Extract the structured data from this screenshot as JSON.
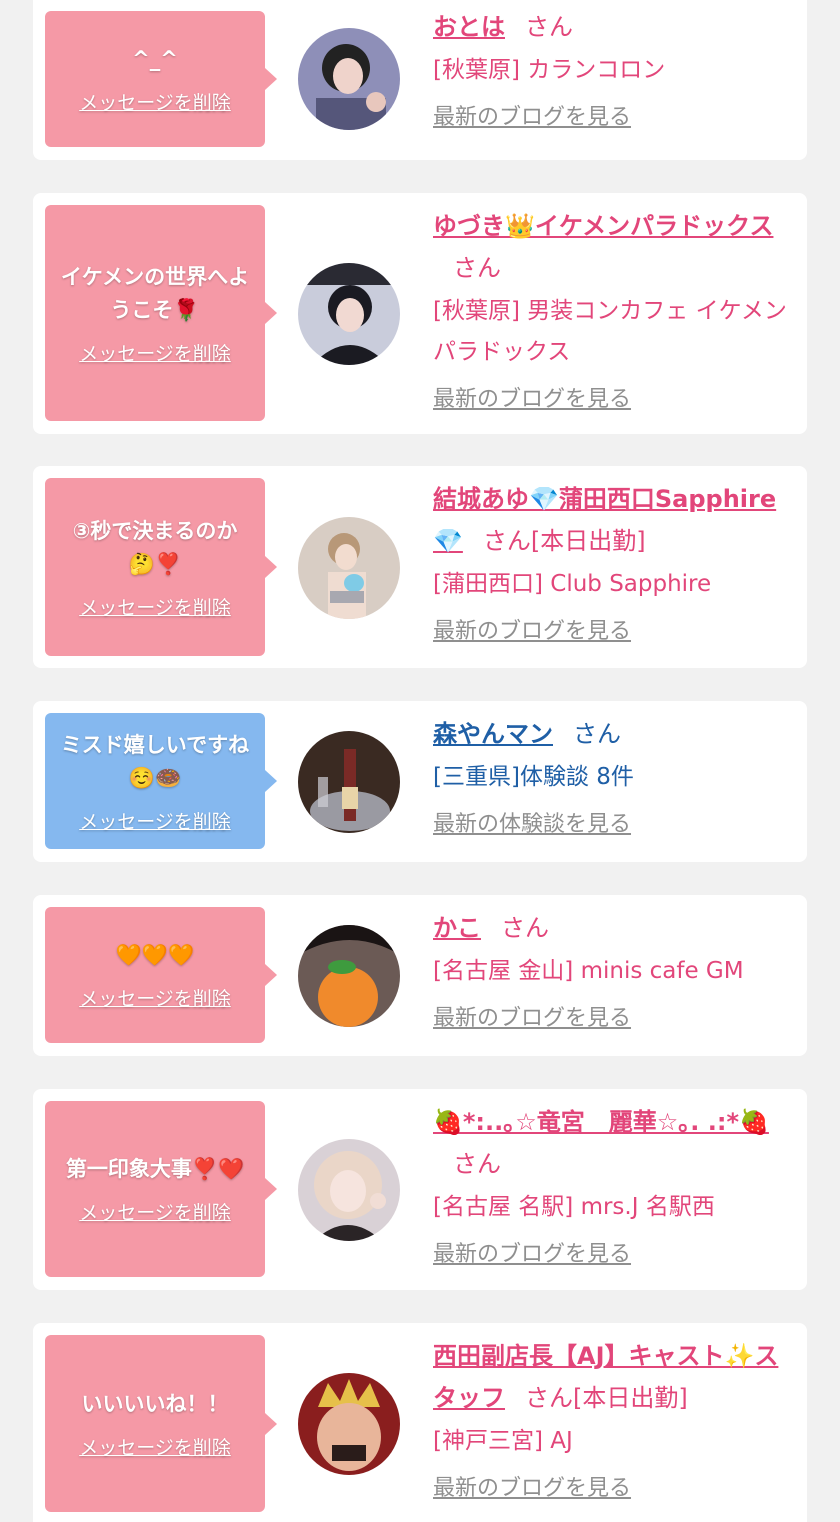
{
  "delete_label": "メッセージを削除",
  "san_label": "さん",
  "cards": [
    {
      "message": "^_^",
      "name": "おとは",
      "extra": "",
      "shop": "[秋葉原] カランコロン",
      "blog": "最新のブログを見る"
    },
    {
      "message": "イケメンの世界へようこそ🌹",
      "name": "ゆづき👑イケメンパラドックス",
      "extra": "",
      "shop": "[秋葉原] 男装コンカフェ イケメンパラドックス",
      "blog": "最新のブログを見る"
    },
    {
      "message": "③秒で決まるのか🤔❣️",
      "name": "結城あゆ💎蒲田西口Sapphire💎",
      "extra": "[本日出勤]",
      "shop": "[蒲田西口] Club Sapphire",
      "blog": "最新のブログを見る"
    },
    {
      "message": "ミスド嬉しいですね☺️🍩",
      "name": "森やんマン",
      "extra": "",
      "shop": "[三重県]体験談 8件",
      "blog": "最新の体験談を見る"
    },
    {
      "message": "🧡🧡🧡",
      "name": "かこ",
      "extra": "",
      "shop": "[名古屋 金山] minis cafe GM",
      "blog": "最新のブログを見る"
    },
    {
      "message": "第一印象大事❣️❤️",
      "name": "🍓*:..｡☆竜宮　麗華☆｡. .:*🍓",
      "extra": "",
      "shop": "[名古屋 名駅] mrs.J 名駅西",
      "blog": "最新のブログを見る"
    },
    {
      "message": "いいいいね！！",
      "name": "西田副店長【AJ】キャスト✨スタッフ",
      "extra": "[本日出勤]",
      "shop": "[神戸三宮] AJ",
      "blog": "最新のブログを見る"
    }
  ],
  "colors": {
    "pink_bubble": "#f599a6",
    "blue_bubble": "#85b8ef",
    "pink_text": "#e2467a",
    "blue_text": "#1f5fa6",
    "link_gray": "#8f8f8f",
    "background": "#f1f1f1"
  },
  "avatar_icons": [
    "avatar-girl-dark-hair",
    "avatar-boy-black-hair",
    "avatar-girl-blonde",
    "avatar-champagne-bottle",
    "avatar-orange-sticker-face",
    "avatar-blonde-girl-peace",
    "avatar-man-with-crown"
  ]
}
